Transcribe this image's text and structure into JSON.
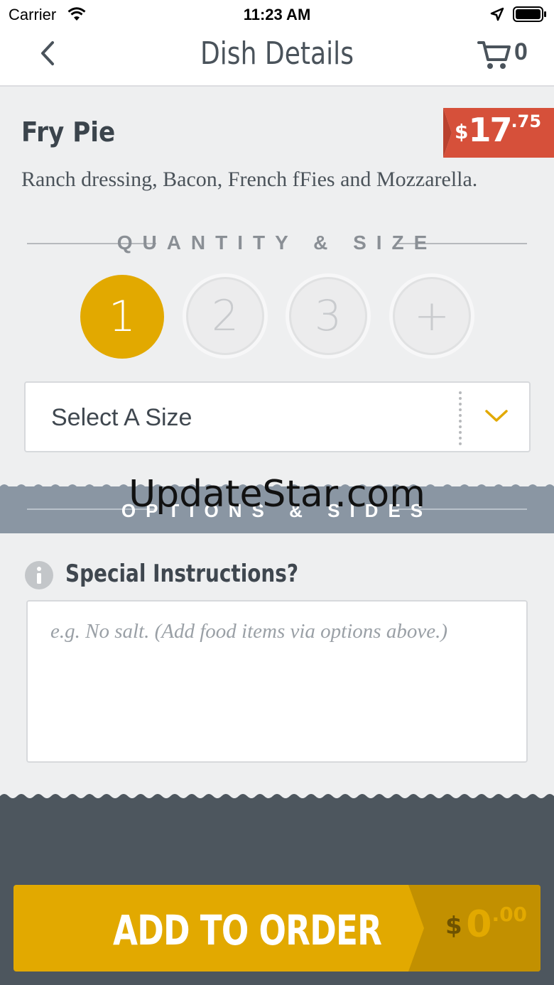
{
  "status_bar": {
    "carrier": "Carrier",
    "time": "11:23 AM"
  },
  "nav": {
    "title": "Dish Details",
    "cart_count": "0"
  },
  "dish": {
    "name": "Fry Pie",
    "price_currency": "$",
    "price_main": "17",
    "price_cents": ".75",
    "description": "Ranch dressing, Bacon, French fFies and Mozzarella."
  },
  "quantity_section": {
    "title": "QUANTITY & SIZE",
    "options": [
      "1",
      "2",
      "3",
      "+"
    ],
    "selected": "1"
  },
  "size_select": {
    "value": "Select A Size"
  },
  "options_section": {
    "title": "OPTIONS & SIDES"
  },
  "watermark": "UpdateStar.com",
  "instructions": {
    "label": "Special Instructions?",
    "placeholder": "e.g. No salt. (Add food items via options above.)"
  },
  "footer": {
    "add_label": "ADD TO ORDER",
    "total_currency": "$",
    "total_main": "0",
    "total_cents": ".00"
  },
  "colors": {
    "accent": "#e2a900",
    "price_tag": "#d6503a",
    "footer": "#4d565e",
    "options_band": "#8a96a3"
  }
}
